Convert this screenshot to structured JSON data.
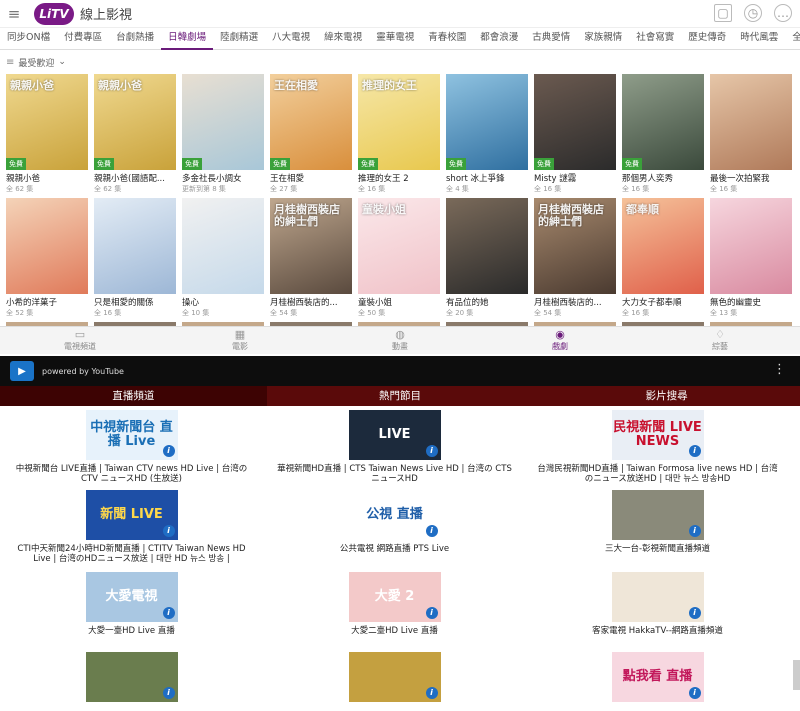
{
  "app": {
    "brand_logo": "LiTV",
    "brand_name": "線上影視"
  },
  "categories": [
    "同步ON檔",
    "付費專區",
    "台劇熱播",
    "日韓劇場",
    "陸劇精選",
    "八大電視",
    "緯來電視",
    "靈華電視",
    "青春校園",
    "都會浪漫",
    "古典愛情",
    "家族親情",
    "社會寫實",
    "歷史傳奇",
    "時代風雲",
    "全部"
  ],
  "active_category_index": 3,
  "sort": {
    "label": "最受歡迎",
    "lines_icon": "≡",
    "chevron_icon": "⌄"
  },
  "top_icons": {
    "cart": "🛒",
    "clock": "⏱",
    "chat": "💬"
  },
  "badge_label": "免費",
  "dramas_row1": [
    {
      "title": "親親小爸",
      "sub": "全 62 集",
      "badge": true,
      "text": "親親小爸",
      "c1": "#c9a23a",
      "c2": "#f0d990"
    },
    {
      "title": "親親小爸(國語配...",
      "sub": "全 62 集",
      "badge": true,
      "text": "親親小爸",
      "c1": "#c9a23a",
      "c2": "#f0d990"
    },
    {
      "title": "多金社長小調女",
      "sub": "更新到第 8 集",
      "badge": true,
      "text": "",
      "c1": "#a8c7d8",
      "c2": "#e8dfd2"
    },
    {
      "title": "王在相愛",
      "sub": "全 27 集",
      "badge": true,
      "text": "王在相愛",
      "c1": "#d98f3c",
      "c2": "#f2cf9c"
    },
    {
      "title": "推理的女王 2",
      "sub": "全 16 集",
      "badge": true,
      "text": "推理的女王",
      "c1": "#e8c84e",
      "c2": "#f6e7a8"
    },
    {
      "title": "short 冰上爭鋒",
      "sub": "全 4 集",
      "badge": true,
      "text": "",
      "c1": "#2f6fa0",
      "c2": "#8fc2e0"
    },
    {
      "title": "Misty 謎霧",
      "sub": "全 16 集",
      "badge": true,
      "text": "",
      "c1": "#2b2b2b",
      "c2": "#6b5a50"
    },
    {
      "title": "那個男人奕秀",
      "sub": "全 16 集",
      "badge": true,
      "text": "",
      "c1": "#3b4a3c",
      "c2": "#8f9d8a"
    },
    {
      "title": "最後一次拍緊我",
      "sub": "全 16 集",
      "badge": false,
      "text": "",
      "c1": "#b07a5a",
      "c2": "#e6c6a8"
    }
  ],
  "dramas_row2": [
    {
      "title": "小希的洋菓子",
      "sub": "全 52 集",
      "badge": false,
      "text": "",
      "c1": "#e07a5a",
      "c2": "#f4d3b8"
    },
    {
      "title": "只是相愛的關係",
      "sub": "全 16 集",
      "badge": false,
      "text": "",
      "c1": "#9db7d6",
      "c2": "#e3ecf5"
    },
    {
      "title": "操心",
      "sub": "全 10 集",
      "badge": false,
      "text": "",
      "c1": "#c5d9ea",
      "c2": "#f1f1f1"
    },
    {
      "title": "月桂樹西裝店的...",
      "sub": "全 54 集",
      "badge": false,
      "text": "月桂樹西裝店的紳士們",
      "c1": "#5a4a3e",
      "c2": "#bfa78e"
    },
    {
      "title": "童裝小姐",
      "sub": "全 50 集",
      "badge": false,
      "text": "童裝小姐",
      "c1": "#f0c2c8",
      "c2": "#fbe8ea"
    },
    {
      "title": "有品位的她",
      "sub": "全 20 集",
      "badge": false,
      "text": "",
      "c1": "#2a2a2a",
      "c2": "#7a6a5a"
    },
    {
      "title": "月桂樹西裝店的...",
      "sub": "全 54 集",
      "badge": false,
      "text": "月桂樹西裝店的紳士們",
      "c1": "#4a3a30",
      "c2": "#a88a6e"
    },
    {
      "title": "大力女子都奉順",
      "sub": "全 16 集",
      "badge": false,
      "text": "都奉順",
      "c1": "#e0604a",
      "c2": "#f5c29a"
    },
    {
      "title": "無色的幽靈史",
      "sub": "全 13 集",
      "badge": false,
      "text": "",
      "c1": "#d98aa0",
      "c2": "#f6d6de"
    }
  ],
  "bottom_nav": [
    {
      "label": "電視頻道",
      "icon": "▭"
    },
    {
      "label": "電影",
      "icon": "▦"
    },
    {
      "label": "動畫",
      "icon": "◍"
    },
    {
      "label": "戲劇",
      "icon": "◉"
    },
    {
      "label": "綜藝",
      "icon": "♢"
    }
  ],
  "active_nav_index": 3,
  "youtube": {
    "powered_by": "powered by YouTube",
    "menu_icon": "⋮",
    "app_icon": "▶",
    "tabs": [
      "直播頻道",
      "熱門節目",
      "影片搜尋"
    ],
    "active_tab_index": 0,
    "info_icon": "i",
    "channels": [
      {
        "title": "中視新聞台 LIVE直播 | Taiwan CTV news HD Live | 台湾のCTV ニュースHD (生放送)",
        "thumb": "中視新聞台 直播 Live",
        "bg": "#e7f2fb",
        "fg": "#1a6fb5"
      },
      {
        "title": "華視新聞HD直播 | CTS Taiwan News Live HD | 台湾の CTS ニュースHD",
        "thumb": "LIVE",
        "bg": "#1c2a3c",
        "fg": "#ffffff"
      },
      {
        "title": "台灣民視新聞HD直播 | Taiwan Formosa live news HD | 台湾のニュース放送HD | 대만 뉴스 방송HD",
        "thumb": "民視新聞 LIVE NEWS",
        "bg": "#e9eef5",
        "fg": "#c8102e"
      },
      {
        "title": "CTI中天新聞24小時HD新聞直播 | CTITV Taiwan News HD Live | 台湾のHDニュース放送 | 대만 HD 뉴스 방송 |",
        "thumb": "新聞 LIVE",
        "bg": "#1e4fa6",
        "fg": "#ffd84a"
      },
      {
        "title": "公共電視 網路直播 PTS Live",
        "thumb": "公視 直播",
        "bg": "#ffffff",
        "fg": "#1f5ea8"
      },
      {
        "title": "三大一台-彰視新聞直播頻道",
        "thumb": "",
        "bg": "#8a8a7a",
        "fg": "#ffffff"
      },
      {
        "title": "大愛一臺HD Live 直播",
        "thumb": "大愛電視",
        "bg": "#a9c7e2",
        "fg": "#ffffff"
      },
      {
        "title": "大愛二臺HD Live 直播",
        "thumb": "大愛 2",
        "bg": "#f3c9c9",
        "fg": "#ffffff"
      },
      {
        "title": "客家電視 HakkaTV--網路直播頻道",
        "thumb": "",
        "bg": "#efe6d8",
        "fg": "#555555"
      },
      {
        "title": "",
        "thumb": "",
        "bg": "#6a7d4e",
        "fg": "#ffffff"
      },
      {
        "title": "",
        "thumb": "",
        "bg": "#c4a040",
        "fg": "#ffffff"
      },
      {
        "title": "",
        "thumb": "點我看 直播",
        "bg": "#f7d7e0",
        "fg": "#c2185b"
      }
    ]
  }
}
